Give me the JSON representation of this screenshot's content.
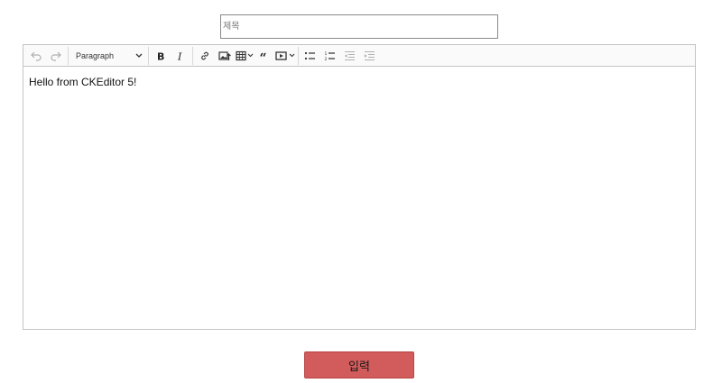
{
  "title_field": {
    "placeholder": "제목",
    "value": ""
  },
  "toolbar": {
    "undo_icon": "undo-icon",
    "redo_icon": "redo-icon",
    "heading_label": "Paragraph",
    "bold_icon": "bold-icon",
    "italic_icon": "italic-icon",
    "link_icon": "link-icon",
    "image_upload_icon": "image-upload-icon",
    "table_icon": "table-icon",
    "blockquote_icon": "blockquote-icon",
    "media_icon": "media-embed-icon",
    "bulleted_list_icon": "bulleted-list-icon",
    "numbered_list_icon": "numbered-list-icon",
    "outdent_icon": "outdent-icon",
    "indent_icon": "indent-icon"
  },
  "editor": {
    "content": "Hello from CKEditor 5!"
  },
  "submit": {
    "label": "입력",
    "color": "#d25b5b"
  }
}
